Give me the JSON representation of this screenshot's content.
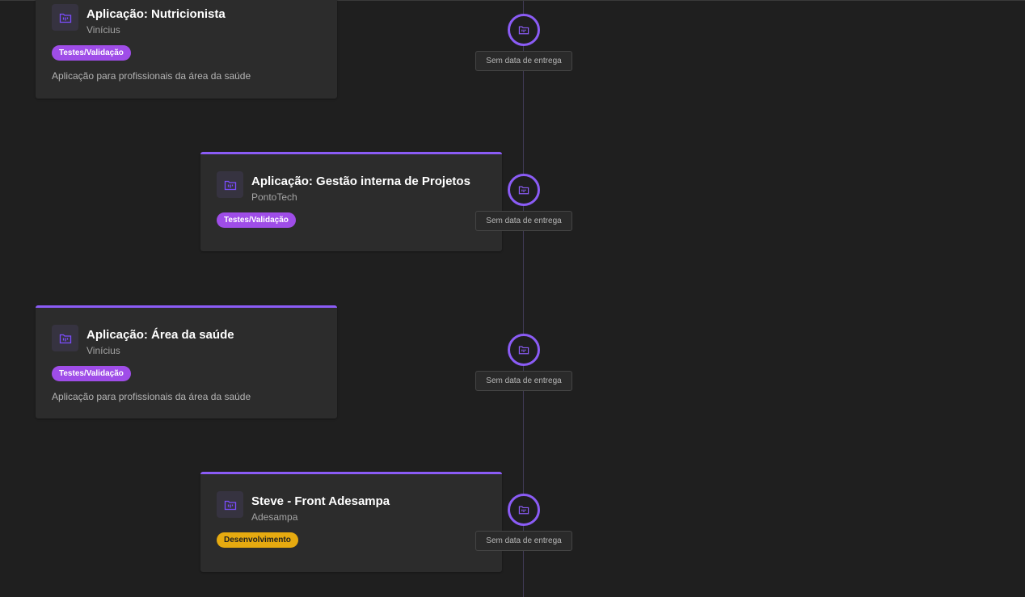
{
  "colors": {
    "background": "#1f1f1f",
    "card": "#2c2c2c",
    "accent": "#8b5cf6",
    "badge_testing": "#9f4de8",
    "badge_development": "#e6aa10"
  },
  "icons": {
    "project": "folder-kanban-icon"
  },
  "timeline": {
    "items": [
      {
        "title": "Aplicação: Nutricionista",
        "client": "Vinícius",
        "status": "Testes/Validação",
        "description": "Aplicação para profissionais da área da saúde",
        "delivery": "Sem data de entrega"
      },
      {
        "title": "Aplicação: Gestão interna de Projetos",
        "client": "PontoTech",
        "status": "Testes/Validação",
        "description": "",
        "delivery": "Sem data de entrega"
      },
      {
        "title": "Aplicação: Área da saúde",
        "client": "Vinícius",
        "status": "Testes/Validação",
        "description": "Aplicação para profissionais da área da saúde",
        "delivery": "Sem data de entrega"
      },
      {
        "title": "Steve - Front Adesampa",
        "client": "Adesampa",
        "status": "Desenvolvimento",
        "description": "",
        "delivery": "Sem data de entrega"
      }
    ]
  }
}
